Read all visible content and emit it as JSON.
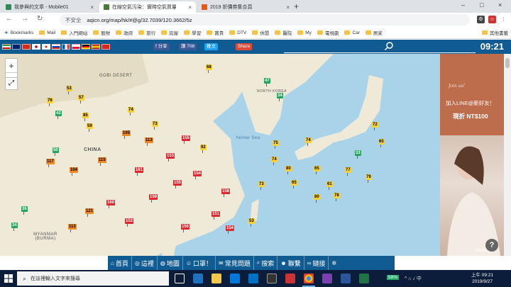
{
  "browser": {
    "tabs": [
      {
        "label": "我參與的文章 - Mobile01",
        "active": false,
        "favicon_color": "#2e8b57"
      },
      {
        "label": "在線空氣污染：實時空氣質量指數地圖",
        "active": true,
        "favicon_color": "#4a7a3a"
      },
      {
        "label": "2019 折價券集合頁",
        "active": false,
        "favicon_color": "#e05c1a"
      }
    ],
    "new_tab": "+",
    "window_controls": [
      "–",
      "□",
      "×"
    ],
    "security_label": "不安全",
    "url": "aqicn.org/map/hk/#@g/32.7039/120.3662/5z",
    "bookmarks": [
      "Bookmarks",
      "Mail",
      "入門網站",
      "股財",
      "政府",
      "旅行",
      "房屋",
      "學習",
      "寶貴",
      "DTV",
      "休閒",
      "醫院",
      "My",
      "電視劇",
      "Car",
      "居家",
      "其他書籤"
    ]
  },
  "site_header": {
    "flags": [
      "Iran",
      "UK",
      "China",
      "Japan",
      "Korea",
      "Russia",
      "France",
      "Poland",
      "Germany",
      "Spain",
      "Vietnam"
    ],
    "share_fb": "f 分享",
    "like_count": "讚 708",
    "tweet": "推文",
    "gplus_share": "Share",
    "clock": "09:21"
  },
  "map": {
    "labels": [
      {
        "text": "GOBI DESERT",
        "kind": "region"
      },
      {
        "text": "CHINA",
        "kind": "country"
      },
      {
        "text": "NORTH KOREA",
        "kind": "country"
      },
      {
        "text": "MYANMAR (BURMA)",
        "kind": "country"
      },
      {
        "text": "Yellow Sea",
        "kind": "sea"
      }
    ],
    "zoom_in": "+",
    "zoom_out": "−",
    "fullscreen_icon": "fullscreen-icon",
    "markers": [
      {
        "v": "53",
        "c": "#f7d13c"
      },
      {
        "v": "57",
        "c": "#f7d13c"
      },
      {
        "v": "76",
        "c": "#f7d13c"
      },
      {
        "v": "42",
        "c": "#2ca25f"
      },
      {
        "v": "85",
        "c": "#f7d13c"
      },
      {
        "v": "74",
        "c": "#f7d13c"
      },
      {
        "v": "73",
        "c": "#f7d13c"
      },
      {
        "v": "50",
        "c": "#2ca25f"
      },
      {
        "v": "117",
        "c": "#f08a24"
      },
      {
        "v": "115",
        "c": "#f08a24"
      },
      {
        "v": "104",
        "c": "#f08a24"
      },
      {
        "v": "161",
        "c": "#e0262f"
      },
      {
        "v": "155",
        "c": "#e0262f"
      },
      {
        "v": "159",
        "c": "#e0262f"
      },
      {
        "v": "160",
        "c": "#e0262f"
      },
      {
        "v": "153",
        "c": "#e0262f"
      },
      {
        "v": "156",
        "c": "#e0262f"
      },
      {
        "v": "121",
        "c": "#f08a24"
      },
      {
        "v": "113",
        "c": "#f08a24"
      },
      {
        "v": "151",
        "c": "#e0262f"
      },
      {
        "v": "92",
        "c": "#f7d13c"
      },
      {
        "v": "68",
        "c": "#f7d13c"
      },
      {
        "v": "74",
        "c": "#f7d13c"
      },
      {
        "v": "80",
        "c": "#f7d13c"
      },
      {
        "v": "153",
        "c": "#e0262f"
      },
      {
        "v": "154",
        "c": "#e0262f"
      },
      {
        "v": "158",
        "c": "#e0262f"
      },
      {
        "v": "65",
        "c": "#f7d13c"
      },
      {
        "v": "113",
        "c": "#f08a24"
      },
      {
        "v": "154",
        "c": "#e0262f"
      },
      {
        "v": "36",
        "c": "#2ca25f"
      },
      {
        "v": "34",
        "c": "#2ca25f"
      },
      {
        "v": "155",
        "c": "#e0262f"
      },
      {
        "v": "75",
        "c": "#f7d13c"
      },
      {
        "v": "65",
        "c": "#f7d13c"
      },
      {
        "v": "72",
        "c": "#f7d13c"
      },
      {
        "v": "65",
        "c": "#f7d13c"
      },
      {
        "v": "33",
        "c": "#2ca25f"
      },
      {
        "v": "61",
        "c": "#f7d13c"
      },
      {
        "v": "80",
        "c": "#f7d13c"
      },
      {
        "v": "105",
        "c": "#f08a24"
      },
      {
        "v": "73",
        "c": "#f7d13c"
      },
      {
        "v": "77",
        "c": "#f7d13c"
      },
      {
        "v": "78",
        "c": "#f7d13c"
      },
      {
        "v": "79",
        "c": "#f7d13c"
      },
      {
        "v": "47",
        "c": "#2ca25f"
      },
      {
        "v": "34",
        "c": "#2ca25f"
      },
      {
        "v": "53",
        "c": "#f7d13c"
      },
      {
        "v": "59",
        "c": "#f7d13c"
      },
      {
        "v": "74",
        "c": "#f7d13c"
      }
    ]
  },
  "ad": {
    "script": "Join us!",
    "line1": "加入LINE@新好友！",
    "line2": "現折 NT$100",
    "footer": "2019/9/27",
    "info_icon": "?"
  },
  "bottom_nav": [
    {
      "label": "首頁",
      "icon": "home-icon",
      "glyph": "⌂"
    },
    {
      "label": "這裡",
      "icon": "location-icon",
      "glyph": "◎"
    },
    {
      "label": "地圖",
      "icon": "globe-icon",
      "glyph": "◍"
    },
    {
      "label": "口罩！",
      "icon": "mask-icon",
      "glyph": "☺"
    },
    {
      "label": "常見問題",
      "icon": "faq-icon",
      "glyph": "✉"
    },
    {
      "label": "搜索",
      "icon": "search-icon",
      "glyph": "⌕"
    },
    {
      "label": "聯繫",
      "icon": "people-icon",
      "glyph": "☻"
    },
    {
      "label": "鏈接",
      "icon": "link-icon",
      "glyph": "∞"
    },
    {
      "label": "",
      "icon": "gear-icon",
      "glyph": "✲"
    }
  ],
  "taskbar": {
    "search_placeholder": "在這裡輸入文字來搜尋",
    "battery": "58%",
    "tray": "^ ⌂ ♪ 中",
    "time": "上午 09:21",
    "date": "2019/9/27"
  }
}
